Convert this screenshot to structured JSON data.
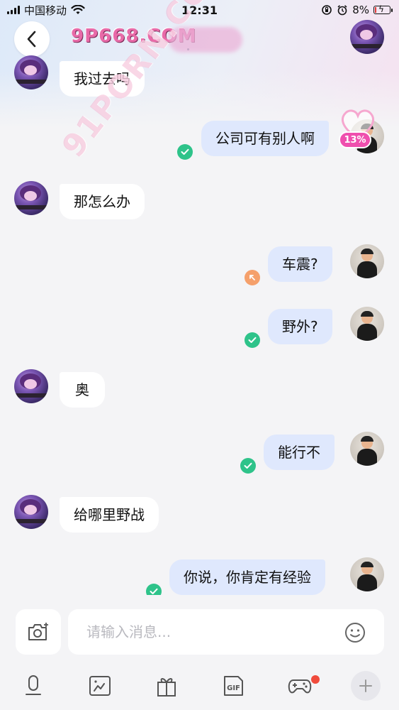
{
  "status_bar": {
    "carrier": "中国移动",
    "time": "12:31",
    "battery": "8%"
  },
  "header": {
    "peer_name": "9P668.COM",
    "watermark_dot": "·"
  },
  "watermark": {
    "text": "91PORN.COM"
  },
  "badge": {
    "percent": "13%"
  },
  "messages": [
    {
      "side": "in",
      "text": "我过去吗",
      "status": ""
    },
    {
      "side": "out",
      "text": "公司可有别人啊",
      "status": "sent"
    },
    {
      "side": "in",
      "text": "那怎么办",
      "status": ""
    },
    {
      "side": "out",
      "text": "车震?",
      "status": "pending"
    },
    {
      "side": "out",
      "text": "野外?",
      "status": "sent"
    },
    {
      "side": "in",
      "text": "奥",
      "status": ""
    },
    {
      "side": "out",
      "text": "能行不",
      "status": "sent"
    },
    {
      "side": "in",
      "text": "给哪里野战",
      "status": ""
    },
    {
      "side": "out",
      "text": "你说，你肯定有经验",
      "status": "sent"
    }
  ],
  "input": {
    "placeholder": "请输入消息..."
  },
  "toolbar": {
    "icons": [
      "microphone-icon",
      "image-icon",
      "gift-icon",
      "gif-icon",
      "gamepad-icon",
      "plus-icon"
    ],
    "gif_label": "GIF"
  },
  "colors": {
    "sent_bubble": "#dfe8fd",
    "recv_bubble": "#ffffff",
    "check": "#2ec38a",
    "pending": "#f5a06b",
    "badge": "#ef4fae"
  }
}
